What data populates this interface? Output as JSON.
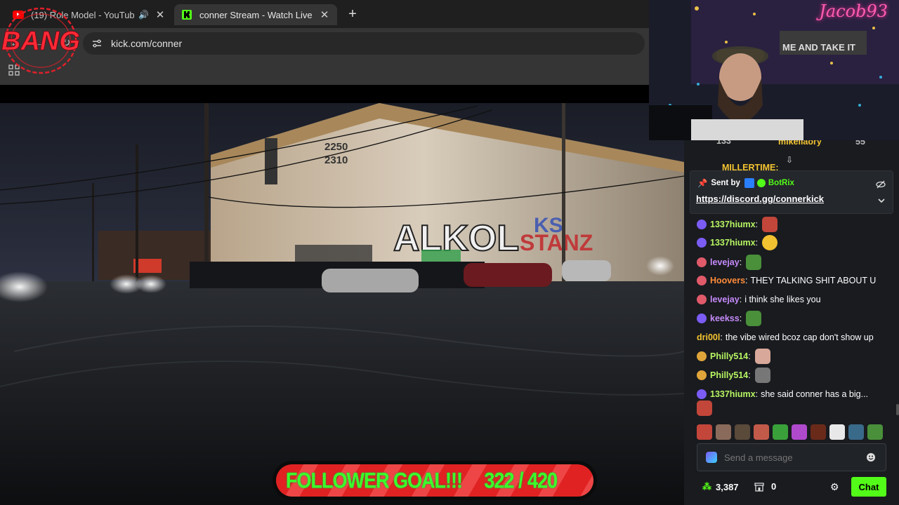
{
  "browser": {
    "tabs": [
      {
        "title": "(19) Role Model - YouTube",
        "icon": "youtube-icon",
        "active": false
      },
      {
        "title": "conner Stream - Watch Live on",
        "icon": "kick-icon",
        "active": true
      }
    ],
    "new_tab": "+",
    "url": "kick.com/conner"
  },
  "overlay": {
    "stamp_text": "BANG",
    "follower_goal_label": "FOLLOWER GOAL!!!",
    "follower_goal_progress": "322 / 420",
    "follower_goal_current": 322,
    "follower_goal_target": 420
  },
  "webcam": {
    "name": "Jacob93",
    "sign_text": "ME AND TAKE IT"
  },
  "chat": {
    "leaderboard": [
      {
        "value": "133"
      },
      {
        "name": "mikellaory",
        "value": "55"
      },
      {
        "name": "MILLERTIME:"
      }
    ],
    "pinned": {
      "sent_by_label": "Sent by",
      "sender": "BotRix",
      "link": "https://discord.gg/connerkick"
    },
    "messages": [
      {
        "user": "1337hiumx",
        "color": "#b7f562",
        "text": "",
        "emote": true
      },
      {
        "user": "1337hiumx",
        "color": "#b7f562",
        "text": "",
        "emote": true
      },
      {
        "user": "levejay",
        "color": "#c58af9",
        "text": "",
        "emote": true
      },
      {
        "user": "Hoovers",
        "color": "#ff8c3a",
        "text": "THEY TALKING SHIT ABOUT U",
        "emote": false
      },
      {
        "user": "levejay",
        "color": "#c58af9",
        "text": "i think she likes you",
        "emote": false
      },
      {
        "user": "keekss",
        "color": "#c58af9",
        "text": "",
        "emote": true
      },
      {
        "user": "dri00l",
        "color": "#f4c430",
        "text": "the vibe wired bcoz cap don't show up",
        "emote": false,
        "no_badge": true
      },
      {
        "user": "Philly514",
        "color": "#b7f562",
        "text": "",
        "emote": true
      },
      {
        "user": "Philly514",
        "color": "#b7f562",
        "text": "",
        "emote": true
      },
      {
        "user": "1337hiumx",
        "color": "#b7f562",
        "text": "she said conner has a big...",
        "emote": false
      }
    ],
    "input_placeholder": "Send a message",
    "points": "3,387",
    "store_count": "0",
    "chat_button": "Chat"
  },
  "colors": {
    "kick_green": "#53fc18",
    "chat_bg": "#191b1f",
    "goal_red": "#e02222",
    "goal_text": "#3cff2a"
  }
}
